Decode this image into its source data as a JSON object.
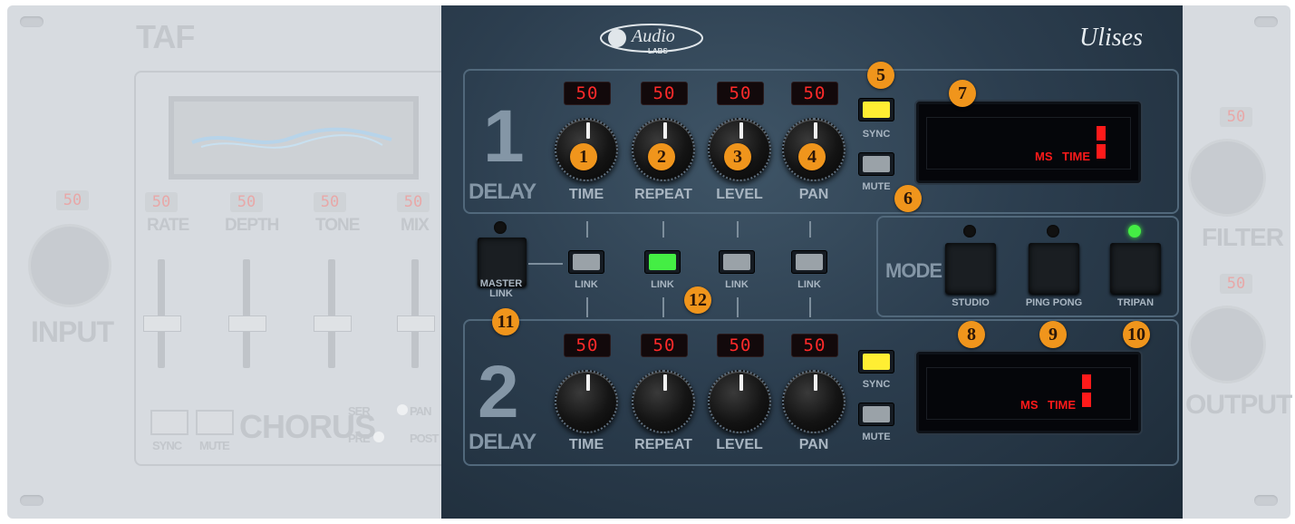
{
  "brand": {
    "name": "TAF",
    "logo_text": "Audio",
    "logo_sub": "LABS",
    "signature": "Ulises"
  },
  "chorus": {
    "title": "CHORUS",
    "params": [
      {
        "label": "RATE",
        "value": "50"
      },
      {
        "label": "DEPTH",
        "value": "50"
      },
      {
        "label": "TONE",
        "value": "50"
      },
      {
        "label": "MIX",
        "value": "50"
      }
    ],
    "sync_label": "SYNC",
    "mute_label": "MUTE",
    "routing": {
      "ser": "SER",
      "pan": "PAN",
      "pre": "PRE",
      "post": "POST"
    }
  },
  "input": {
    "label": "INPUT",
    "value": "50"
  },
  "filter": {
    "label": "FILTER",
    "value": "50"
  },
  "output": {
    "label": "OUTPUT",
    "value": "50"
  },
  "delay1": {
    "number": "1",
    "label": "DELAY",
    "knobs": [
      {
        "label": "TIME",
        "value": "50"
      },
      {
        "label": "REPEAT",
        "value": "50"
      },
      {
        "label": "LEVEL",
        "value": "50"
      },
      {
        "label": "PAN",
        "value": "50"
      }
    ],
    "sync_label": "SYNC",
    "mute_label": "MUTE",
    "display": {
      "ms": "MS",
      "time": "TIME"
    }
  },
  "delay2": {
    "number": "2",
    "label": "DELAY",
    "knobs": [
      {
        "label": "TIME",
        "value": "50"
      },
      {
        "label": "REPEAT",
        "value": "50"
      },
      {
        "label": "LEVEL",
        "value": "50"
      },
      {
        "label": "PAN",
        "value": "50"
      }
    ],
    "sync_label": "SYNC",
    "mute_label": "MUTE",
    "display": {
      "ms": "MS",
      "time": "TIME"
    }
  },
  "link": {
    "master_label": "MASTER\nLINK",
    "buttons": [
      {
        "label": "LINK",
        "active": false
      },
      {
        "label": "LINK",
        "active": true
      },
      {
        "label": "LINK",
        "active": false
      },
      {
        "label": "LINK",
        "active": false
      }
    ]
  },
  "mode": {
    "label": "MODE",
    "options": [
      {
        "label": "STUDIO",
        "active": false
      },
      {
        "label": "PING PONG",
        "active": false
      },
      {
        "label": "TRIPAN",
        "active": true
      }
    ]
  },
  "badges": [
    "1",
    "2",
    "3",
    "4",
    "5",
    "6",
    "7",
    "8",
    "9",
    "10",
    "11",
    "12"
  ],
  "colors": {
    "sync_on": "#ffee33",
    "link_on": "#44ee44",
    "led_red": "#ff2a2a",
    "badge": "#f0951c"
  }
}
